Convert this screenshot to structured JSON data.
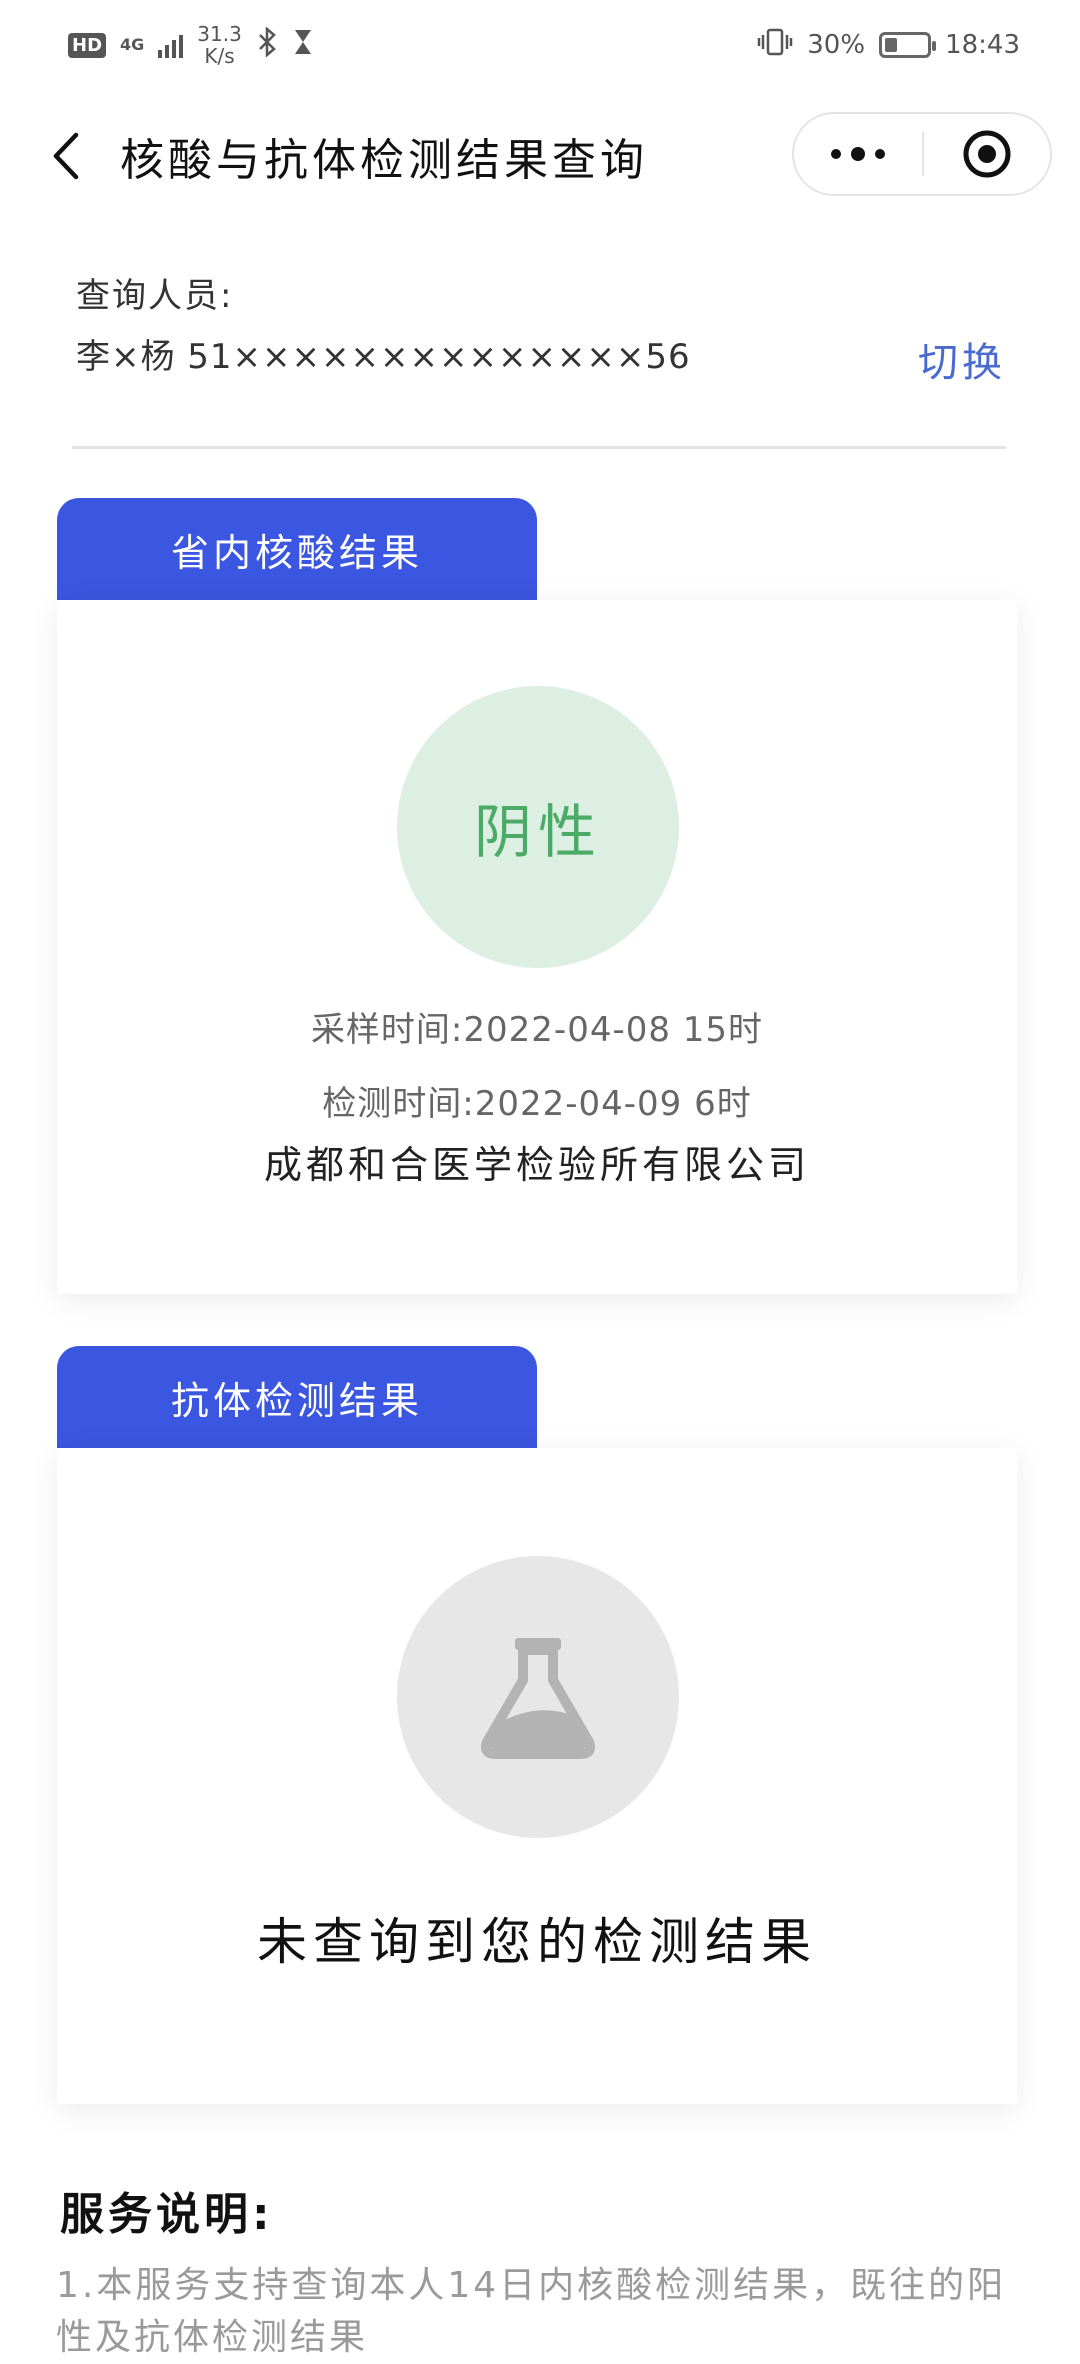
{
  "status_bar": {
    "hd": "HD",
    "network": "4G",
    "speed": "31.3\nK/s",
    "battery_percent": "30%",
    "battery_level": 0.3,
    "time": "18:43"
  },
  "nav": {
    "title": "核酸与抗体检测结果查询"
  },
  "user": {
    "label": "查询人员:",
    "value": "李×杨 51××××××××××××××56",
    "switch_label": "切换"
  },
  "nucleic": {
    "tab_label": "省内核酸结果",
    "result": "阴性",
    "sampling_time": "采样时间:2022-04-08 15时",
    "test_time": "检测时间:2022-04-09 6时",
    "organization": "成都和合医学检验所有限公司"
  },
  "antibody": {
    "tab_label": "抗体检测结果",
    "empty_message": "未查询到您的检测结果"
  },
  "service": {
    "title": "服务说明:",
    "text": "1.本服务支持查询本人14日内核酸检测结果，既往的阳性及抗体检测结果"
  },
  "colors": {
    "accent": "#3b56e0",
    "negative_bg": "#dcefe2",
    "negative_text": "#4aaa66",
    "link": "#4a6ad0"
  }
}
